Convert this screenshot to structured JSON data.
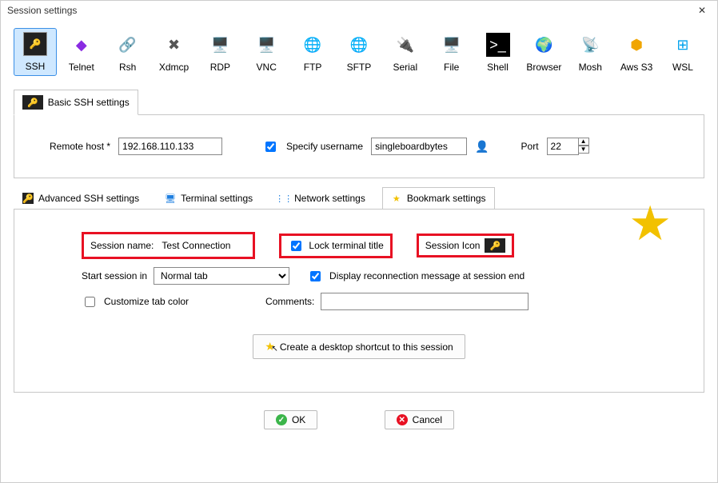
{
  "window": {
    "title": "Session settings"
  },
  "protocols": [
    {
      "name": "ssh",
      "label": "SSH",
      "selected": true
    },
    {
      "name": "telnet",
      "label": "Telnet",
      "selected": false
    },
    {
      "name": "rsh",
      "label": "Rsh",
      "selected": false
    },
    {
      "name": "xdmcp",
      "label": "Xdmcp",
      "selected": false
    },
    {
      "name": "rdp",
      "label": "RDP",
      "selected": false
    },
    {
      "name": "vnc",
      "label": "VNC",
      "selected": false
    },
    {
      "name": "ftp",
      "label": "FTP",
      "selected": false
    },
    {
      "name": "sftp",
      "label": "SFTP",
      "selected": false
    },
    {
      "name": "serial",
      "label": "Serial",
      "selected": false
    },
    {
      "name": "file",
      "label": "File",
      "selected": false
    },
    {
      "name": "shell",
      "label": "Shell",
      "selected": false
    },
    {
      "name": "browser",
      "label": "Browser",
      "selected": false
    },
    {
      "name": "mosh",
      "label": "Mosh",
      "selected": false
    },
    {
      "name": "awss3",
      "label": "Aws S3",
      "selected": false
    },
    {
      "name": "wsl",
      "label": "WSL",
      "selected": false
    }
  ],
  "basic": {
    "tab_label": "Basic SSH settings",
    "remote_host_label": "Remote host *",
    "remote_host_value": "192.168.110.133",
    "specify_username_label": "Specify username",
    "specify_username_checked": true,
    "username_value": "singleboardbytes",
    "port_label": "Port",
    "port_value": "22"
  },
  "lower_tabs": [
    {
      "id": "adv",
      "label": "Advanced SSH settings",
      "active": false,
      "icon": "key-icon"
    },
    {
      "id": "term",
      "label": "Terminal settings",
      "active": false,
      "icon": "terminal-icon"
    },
    {
      "id": "net",
      "label": "Network settings",
      "active": false,
      "icon": "network-icon"
    },
    {
      "id": "bkm",
      "label": "Bookmark settings",
      "active": true,
      "icon": "star-icon"
    }
  ],
  "bookmark": {
    "session_name_label": "Session name:",
    "session_name_value": "Test Connection",
    "lock_title_label": "Lock terminal title",
    "lock_title_checked": true,
    "session_icon_label": "Session Icon",
    "start_label": "Start session in",
    "start_value": "Normal tab",
    "display_reconn_label": "Display reconnection message at session end",
    "display_reconn_checked": true,
    "customize_tab_label": "Customize tab color",
    "customize_tab_checked": false,
    "comments_label": "Comments:",
    "comments_value": "",
    "shortcut_btn_label": "Create a desktop shortcut to this session"
  },
  "footer": {
    "ok": "OK",
    "cancel": "Cancel"
  }
}
